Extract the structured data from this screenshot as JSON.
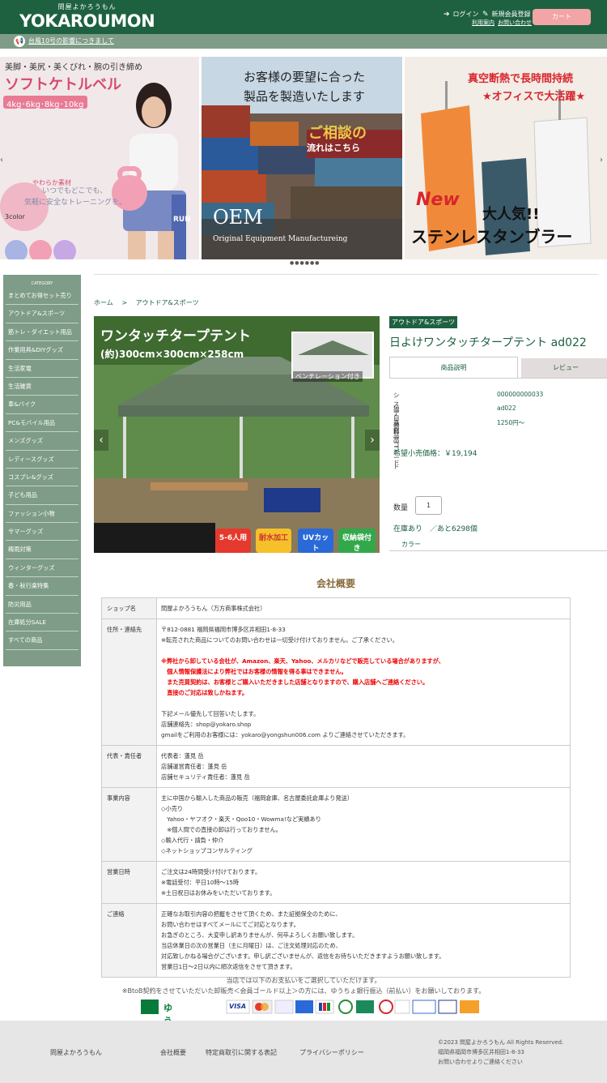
{
  "header": {
    "logo_small": "問屋よかろうもん",
    "logo_main": "YOKAROUMON",
    "login": "ログイン",
    "register": "新規会員登録",
    "guide": "利用案内",
    "contact": "お問い合わせ",
    "cart": "カート"
  },
  "notice": {
    "text": "台風10号の影響につきまして"
  },
  "banners": {
    "b1": {
      "line1": "美脚・美尻・美くびれ・腕の引き締め",
      "title": "ソフトケトルベル",
      "weights": "4kg･6kg･8kg･10kg",
      "soft": "やわらか素材",
      "copy1": "いつでもどこでも、",
      "copy2": "気軽に安全なトレーニングを。",
      "colors": "3color",
      "run": "RUN"
    },
    "b2": {
      "line1": "お客様の要望に合った",
      "line2": "製品を製造いたします",
      "consult1": "ご相談の",
      "consult2": "流れはこちら",
      "oem": "OEM",
      "oem_full": "Original Equipment Manufactureing"
    },
    "b3": {
      "line1": "真空断熱で長時間持続",
      "line2": "★オフィスで大活躍★",
      "new": "New",
      "pop": "大人気!!",
      "name": "ステンレスタンブラー"
    }
  },
  "sidebar": {
    "title": "CATEGORY",
    "items": [
      "まとめてお得セット売り",
      "アウトドア&スポーツ",
      "筋トレ・ダイエット用品",
      "作業用具&DIYグッズ",
      "生活家電",
      "生活雑貨",
      "車&バイク",
      "PC&モバイル用品",
      "メンズグッズ",
      "レディースグッズ",
      "コスプレ&グッズ",
      "子ども用品",
      "ファッション小物",
      "サマーグッズ",
      "梅雨対策",
      "ウィンターグッズ",
      "春・秋行楽特集",
      "防災用品",
      "在庫処分SALE",
      "すべての商品"
    ]
  },
  "breadcrumb": {
    "home": "ホーム",
    "sep": ">",
    "category": "アウトドア&スポーツ"
  },
  "product_image": {
    "title": "ワンタッチタープテント",
    "size": "(約)300cm×300cm×258cm",
    "vent": "ベンチレーション付き",
    "badge1": "5-6人用",
    "badge2": "耐水加工",
    "badge3": "UVカット",
    "badge4": "収納袋付き"
  },
  "product": {
    "category": "アウトドア&スポーツ",
    "title": "日よけワンタッチタープテント ad022",
    "tab_desc": "商品説明",
    "tab_review": "レビュー",
    "specs": [
      {
        "k": "システム商品コード",
        "v": "000000000033"
      },
      {
        "k": "独自商品コード",
        "v": "ad022"
      },
      {
        "k": "送料",
        "v": "1250円〜"
      }
    ],
    "price": "希望小売価格：￥19,194",
    "qty_label": "数量",
    "qty_value": "1",
    "stock": "在庫あり　／あと6298個",
    "color_label": "カラー"
  },
  "company": {
    "title": "会社概要",
    "shop_label": "ショップ名",
    "shop_value": "問屋よかろうもん（万方商事株式会社）",
    "address_label": "住所・連絡先",
    "address_lines": [
      "〒812-0881 福岡県福岡市博多区井相田1-8-33",
      "※転売された商品についてのお問い合わせは一切受け付けておりません。ご了承ください。"
    ],
    "warn_lines": [
      "※弊社から卸している会社が、Amazon、楽天、Yahoo、メルカリなどで販売している場合がありますが、",
      "　個人情報保護法により弊社ではお客様の情報を得る事はできません。",
      "　また売買契約は、お客様とご購入いただきました店舗となりますので、購入店舗へご連絡ください。",
      "　直接のご対応は致しかねます。"
    ],
    "mail_lines": [
      "下記メール優先して回答いたします。",
      "店舗連絡先：shop@yokaro.shop",
      "gmailをご利用のお客様には：yokaro@yongshun006.com よりご連絡させていただきます。"
    ],
    "rep_label": "代表・責任者",
    "rep_lines": [
      "代表者：蓬見 岳",
      "店舗運営責任者：蓬見 岳",
      "店舗セキュリティ責任者：蓬見 岳"
    ],
    "biz_label": "事業内容",
    "biz_lines": [
      "主に中国から輸入した商品の販売（福岡倉庫、名古屋委託倉庫より発送）",
      "◇小売り",
      "　Yahoo・ヤフオク・楽天・Qoo10・Wowma!など実績あり",
      "　※個人間での直接の卸は行っておりません。",
      "◇輸入代行・請負・仲介",
      "◇ネットショップコンサルティング"
    ],
    "hours_label": "営業日時",
    "hours_lines": [
      "ご注文は24時間受け付けております。",
      "※電話受付：平日10時〜15時",
      "※土日祝日はお休みをいただいております。"
    ],
    "contact_label": "ご連絡",
    "contact_lines": [
      "正確なお取引内容の把握をさせて頂くため、また証拠保全のために、",
      "お問い合わせはすべてメールにてご対応となります。",
      "お急ぎのところ、大変申し訳ありませんが、何卒よろしくお願い致します。",
      "当店休業日の次の営業日（主に月曜日）は、ご注文処理対応のため、",
      "対応致しかねる場合がございます。申し訳ございませんが、返信をお待ちいただきますようお願い致します。",
      "営業日1日〜2日以内に順次返信をさせて頂きます。"
    ]
  },
  "payment": {
    "line1": "当店では以下のお支払いをご選択していただけます。",
    "line2": "※BtoB契約をさせていただいた卸販売＜会員ゴールド以上＞の方には、ゆうちょ銀行振込（前払い）をお願いしております。",
    "bank": "ゆうちょ銀行",
    "visa": "VISA"
  },
  "footer": {
    "shop": "問屋よかろうもん",
    "about": "会社概要",
    "law": "特定商取引に関する表記",
    "privacy": "プライバシーポリシー",
    "copyright": "©2023 問屋よかろうもん All Rights Reserved.",
    "address": "福岡県福岡市博多区井相田1-8-33",
    "contact": "お問い合わせよりご連絡ください"
  },
  "colors": {
    "brand": "#1e6141",
    "sidebar": "#7e9c87",
    "cart": "#f3a4a4"
  }
}
